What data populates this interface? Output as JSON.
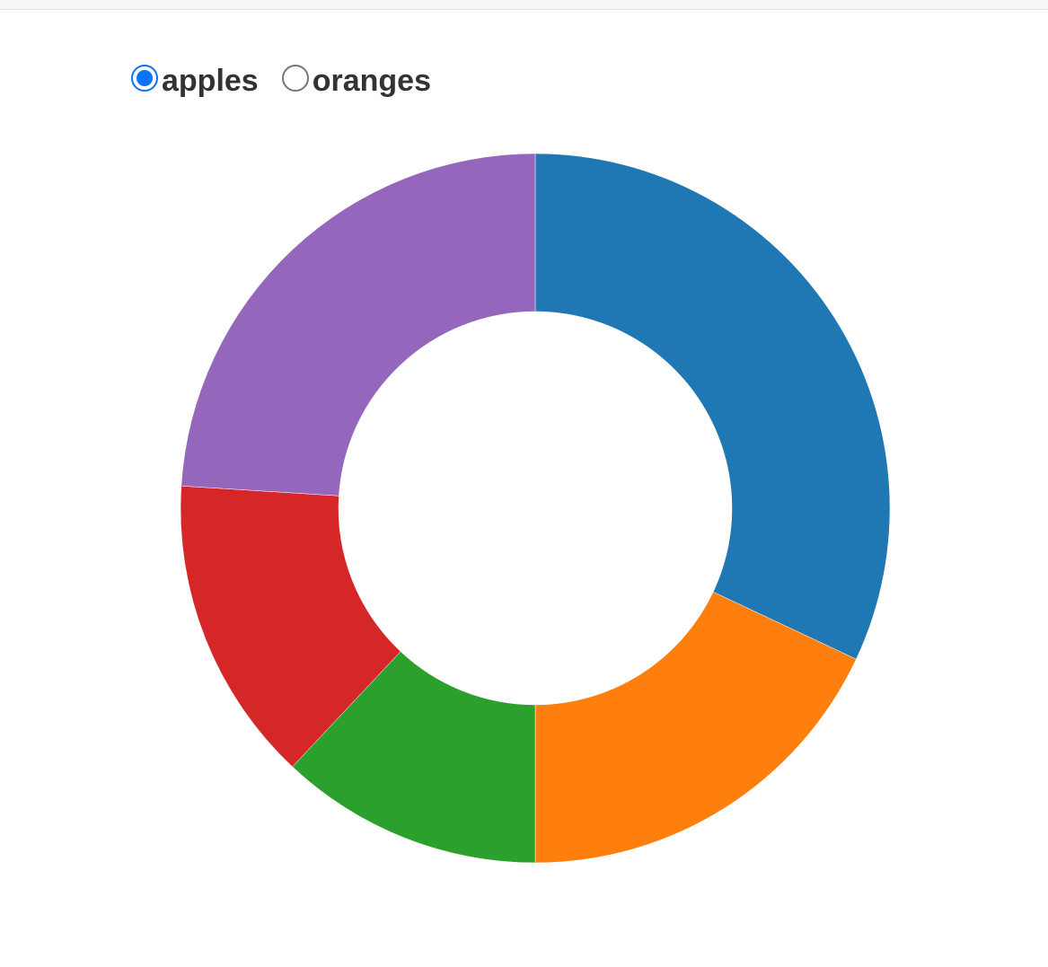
{
  "controls": {
    "options": [
      {
        "label": "apples",
        "checked": true
      },
      {
        "label": "oranges",
        "checked": false
      }
    ],
    "accent_color": "#0b74f5"
  },
  "chart_data": {
    "type": "pie",
    "style": "donut",
    "selected_series": "apples",
    "categories": [
      "",
      "",
      "",
      "",
      ""
    ],
    "values": [
      32,
      18,
      12,
      14,
      24
    ],
    "colors": [
      "#1f77b4",
      "#ff7f0e",
      "#2ca02c",
      "#d62728",
      "#9467bd"
    ],
    "title": "",
    "legend": "none"
  }
}
